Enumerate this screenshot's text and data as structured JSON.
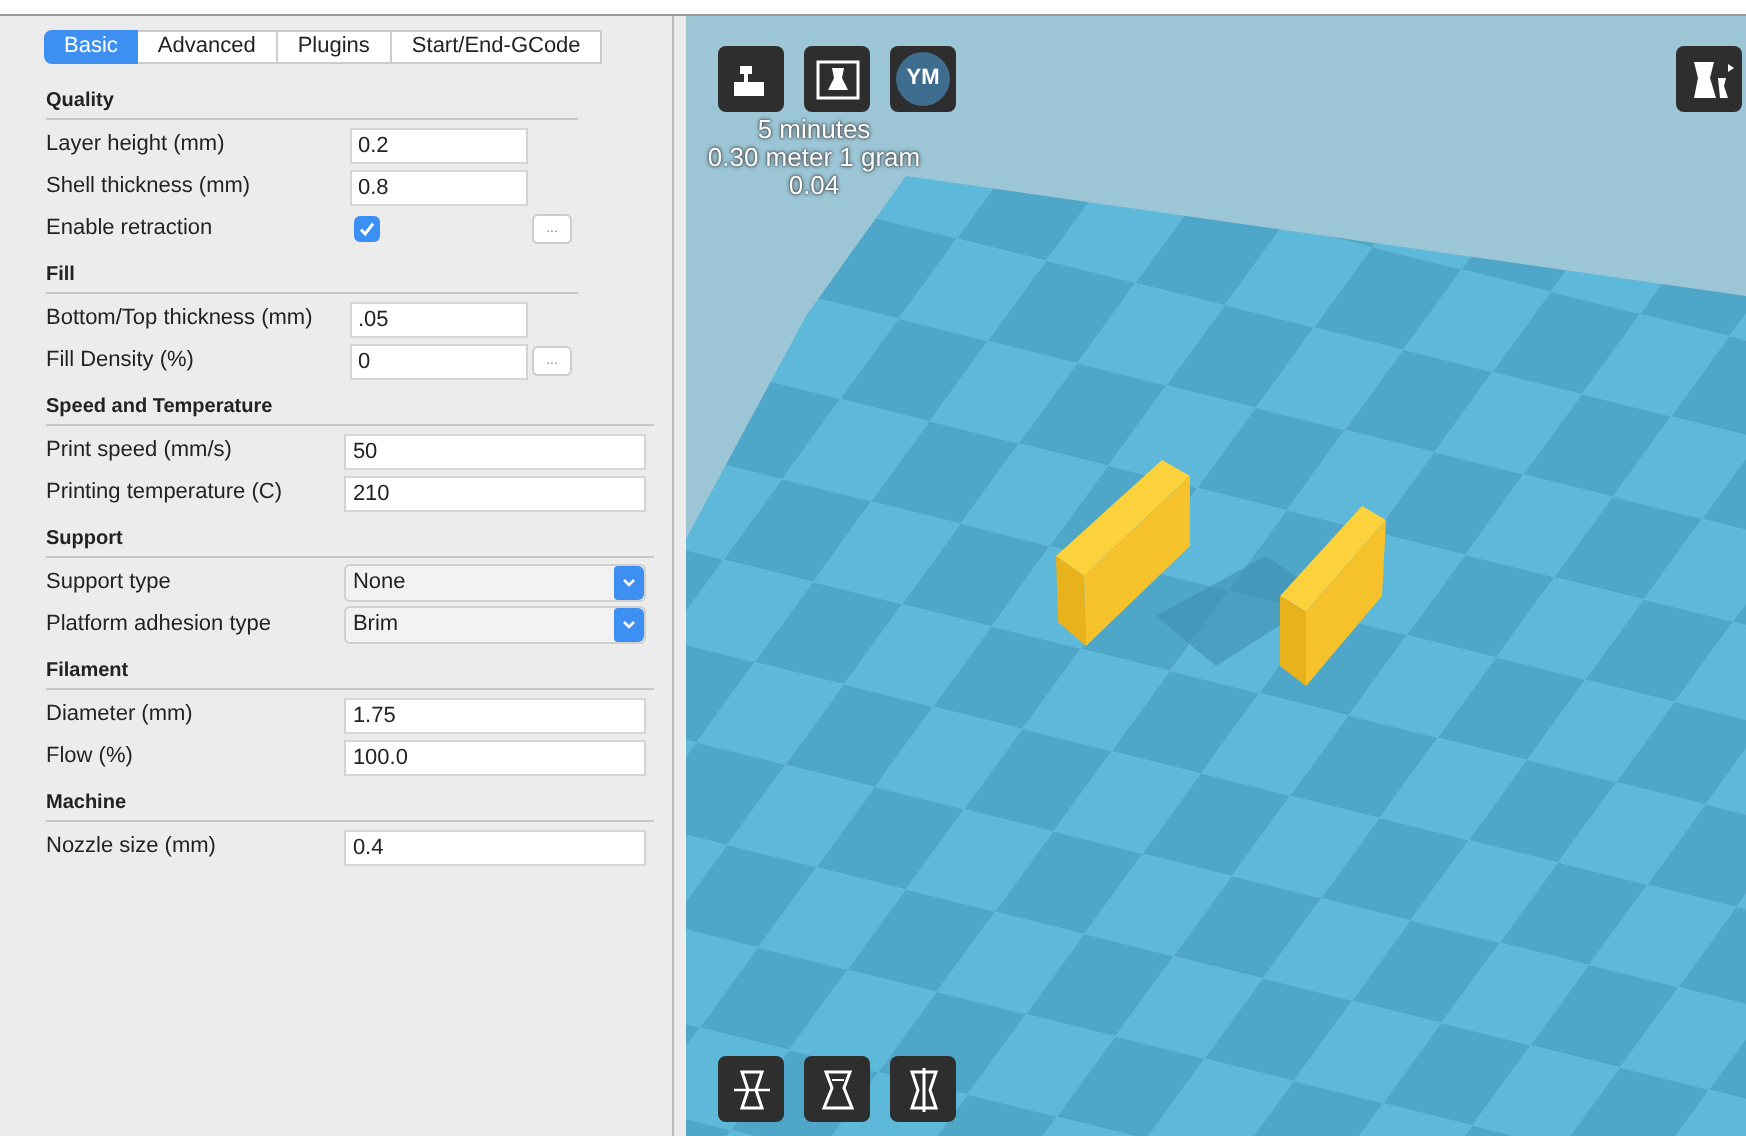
{
  "tabs": [
    {
      "label": "Basic",
      "selected": true
    },
    {
      "label": "Advanced",
      "selected": false
    },
    {
      "label": "Plugins",
      "selected": false
    },
    {
      "label": "Start/End-GCode",
      "selected": false
    }
  ],
  "sections": [
    {
      "title": "Quality",
      "rows": [
        {
          "label": "Layer height (mm)",
          "kind": "short_input",
          "value": "0.2"
        },
        {
          "label": "Shell thickness (mm)",
          "kind": "short_input",
          "value": "0.8"
        },
        {
          "label": "Enable retraction",
          "kind": "checkbox",
          "checked": true,
          "more_button": "..."
        }
      ]
    },
    {
      "title": "Fill",
      "rows": [
        {
          "label": "Bottom/Top thickness (mm)",
          "kind": "short_input",
          "value": ".05"
        },
        {
          "label": "Fill Density (%)",
          "kind": "short_input",
          "value": "0",
          "more_button": "..."
        }
      ]
    },
    {
      "title": "Speed and Temperature",
      "rows": [
        {
          "label": "Print speed (mm/s)",
          "kind": "input",
          "value": "50"
        },
        {
          "label": "Printing temperature (C)",
          "kind": "input",
          "value": "210"
        }
      ]
    },
    {
      "title": "Support",
      "rows": [
        {
          "label": "Support type",
          "kind": "select",
          "value": "None"
        },
        {
          "label": "Platform adhesion type",
          "kind": "select",
          "value": "Brim"
        }
      ]
    },
    {
      "title": "Filament",
      "rows": [
        {
          "label": "Diameter (mm)",
          "kind": "input",
          "value": "1.75"
        },
        {
          "label": "Flow (%)",
          "kind": "input",
          "value": "100.0"
        }
      ]
    },
    {
      "title": "Machine",
      "rows": [
        {
          "label": "Nozzle size (mm)",
          "kind": "input",
          "value": "0.4"
        }
      ]
    }
  ],
  "viewport": {
    "user_badge": "YM",
    "stats": [
      "5 minutes",
      "0.30 meter 1 gram",
      "0.04"
    ]
  }
}
